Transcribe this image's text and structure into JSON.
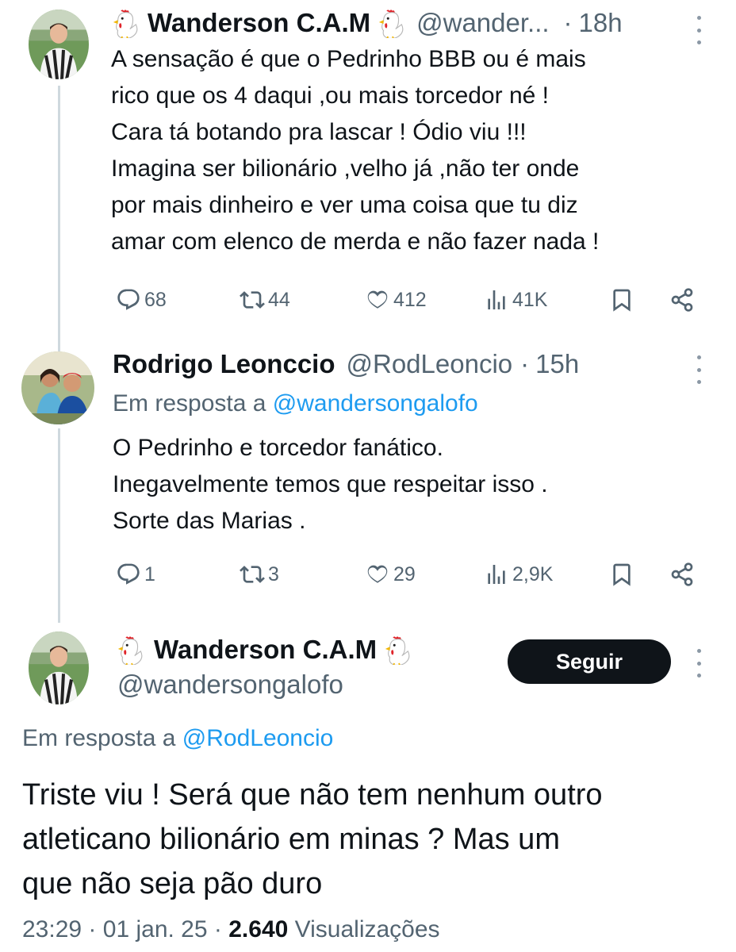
{
  "tweet1": {
    "name": "Wanderson C.A.M",
    "handle": "@wander...",
    "separator": "·",
    "time": "18h",
    "lines": [
      "A sensação é que o Pedrinho BBB ou é mais",
      "rico que os 4 daqui ,ou mais torcedor né !",
      "Cara tá botando pra lascar ! Ódio viu !!!",
      "Imagina ser bilionário ,velho já ,não ter onde",
      "por mais dinheiro e ver uma coisa que tu diz",
      "amar com elenco de merda e não fazer nada !"
    ],
    "replies": "68",
    "retweets": "44",
    "likes": "412",
    "views": "41K"
  },
  "tweet2": {
    "name": "Rodrigo Leonccio",
    "handle": "@RodLeoncio",
    "separator": "·",
    "time": "15h",
    "reply_prefix": "Em resposta a",
    "reply_handle": "@wandersongalofo",
    "lines": [
      "O Pedrinho e torcedor  fanático.",
      "Inegavelmente temos que respeitar isso .",
      "Sorte das Marias ."
    ],
    "replies": "1",
    "retweets": "3",
    "likes": "29",
    "views": "2,9K"
  },
  "main_tweet": {
    "name": "Wanderson C.A.M",
    "handle": "@wandersongalofo",
    "follow_label": "Seguir",
    "reply_prefix": "Em resposta a",
    "reply_handle": "@RodLeoncio",
    "lines": [
      "Triste viu ! Será que não tem nenhum outro",
      "atleticano bilionário em minas ? Mas um",
      "que não seja pão duro"
    ],
    "time": "23:29",
    "date": "01 jan. 25",
    "separator": "·",
    "views_count": "2.640",
    "views_label": "Visualizações"
  },
  "icons": {
    "reply": "speech-bubble-icon",
    "retweet": "retweet-icon",
    "like": "heart-icon",
    "views": "bar-chart-icon",
    "bookmark": "bookmark-icon",
    "share": "share-icon",
    "more": "more-vertical-icon",
    "emoji": "rooster-emoji-icon"
  },
  "colors": {
    "text": "#0f1419",
    "secondary": "#536471",
    "link": "#1d9bf0",
    "thread_line": "#cfd9de",
    "follow_button": "#0f1419"
  }
}
